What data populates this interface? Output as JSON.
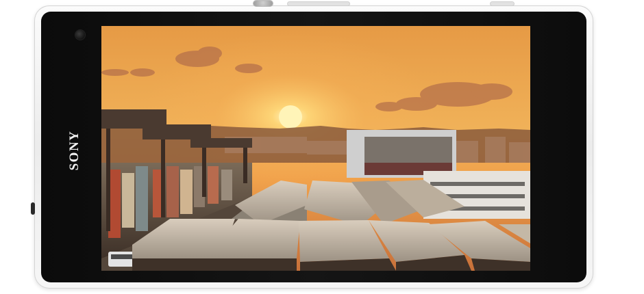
{
  "device": {
    "brand": "SONY"
  },
  "screen": {
    "content": "photo",
    "colors": {
      "sky_top": "#e9a24a",
      "sky_mid": "#f2b457",
      "sun": "#fff3b0",
      "haze": "#e58a3a",
      "roof": "#b7aea2",
      "shadow": "#3a2b22"
    }
  }
}
